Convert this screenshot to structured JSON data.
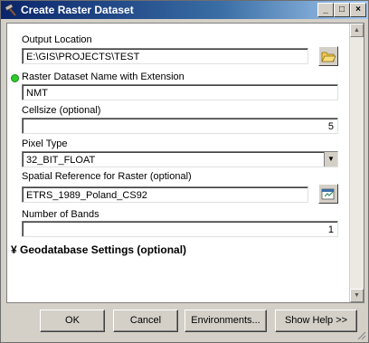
{
  "window": {
    "title": "Create Raster Dataset",
    "minimize_glyph": "_",
    "maximize_glyph": "□",
    "close_glyph": "×"
  },
  "fields": {
    "output_location": {
      "label": "Output Location",
      "value": "E:\\GIS\\PROJECTS\\TEST"
    },
    "raster_name": {
      "label": "Raster Dataset Name with Extension",
      "value": "NMT"
    },
    "cellsize": {
      "label": "Cellsize (optional)",
      "value": "5"
    },
    "pixel_type": {
      "label": "Pixel Type",
      "value": "32_BIT_FLOAT"
    },
    "spatial_reference": {
      "label": "Spatial Reference for Raster (optional)",
      "value": "ETRS_1989_Poland_CS92"
    },
    "number_of_bands": {
      "label": "Number of Bands",
      "value": "1"
    }
  },
  "section": {
    "geodatabase_settings": "Geodatabase Settings (optional)",
    "expand_glyph": "¥"
  },
  "buttons": {
    "ok": "OK",
    "cancel": "Cancel",
    "environments": "Environments...",
    "show_help": "Show Help >>"
  },
  "colors": {
    "title_bar_start": "#0a246a",
    "title_bar_end": "#a6caf0",
    "required_indicator": "#2ecc2e",
    "dialog_face": "#d4d0c8"
  }
}
